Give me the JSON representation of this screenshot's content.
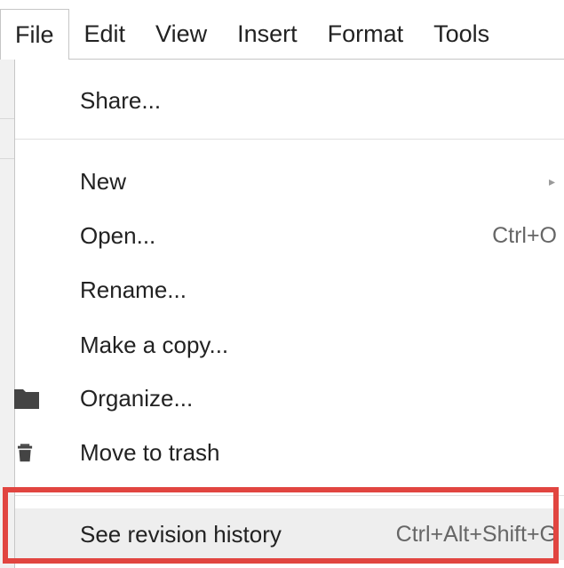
{
  "menubar": {
    "items": [
      {
        "label": "File",
        "active": true
      },
      {
        "label": "Edit"
      },
      {
        "label": "View"
      },
      {
        "label": "Insert"
      },
      {
        "label": "Format"
      },
      {
        "label": "Tools"
      }
    ]
  },
  "file_menu": {
    "share": {
      "label": "Share..."
    },
    "new": {
      "label": "New",
      "has_submenu": true,
      "submenu_arrow": "▸"
    },
    "open": {
      "label": "Open...",
      "shortcut": "Ctrl+O"
    },
    "rename": {
      "label": "Rename..."
    },
    "make_copy": {
      "label": "Make a copy..."
    },
    "organize": {
      "label": "Organize...",
      "icon": "folder-icon"
    },
    "move_to_trash": {
      "label": "Move to trash",
      "icon": "trash-icon"
    },
    "revision_history": {
      "label": "See revision history",
      "shortcut": "Ctrl+Alt+Shift+G",
      "highlighted": true
    }
  },
  "colors": {
    "highlight_box": "#e14540",
    "hover_bg": "#eeeeee",
    "icon": "#444444"
  }
}
